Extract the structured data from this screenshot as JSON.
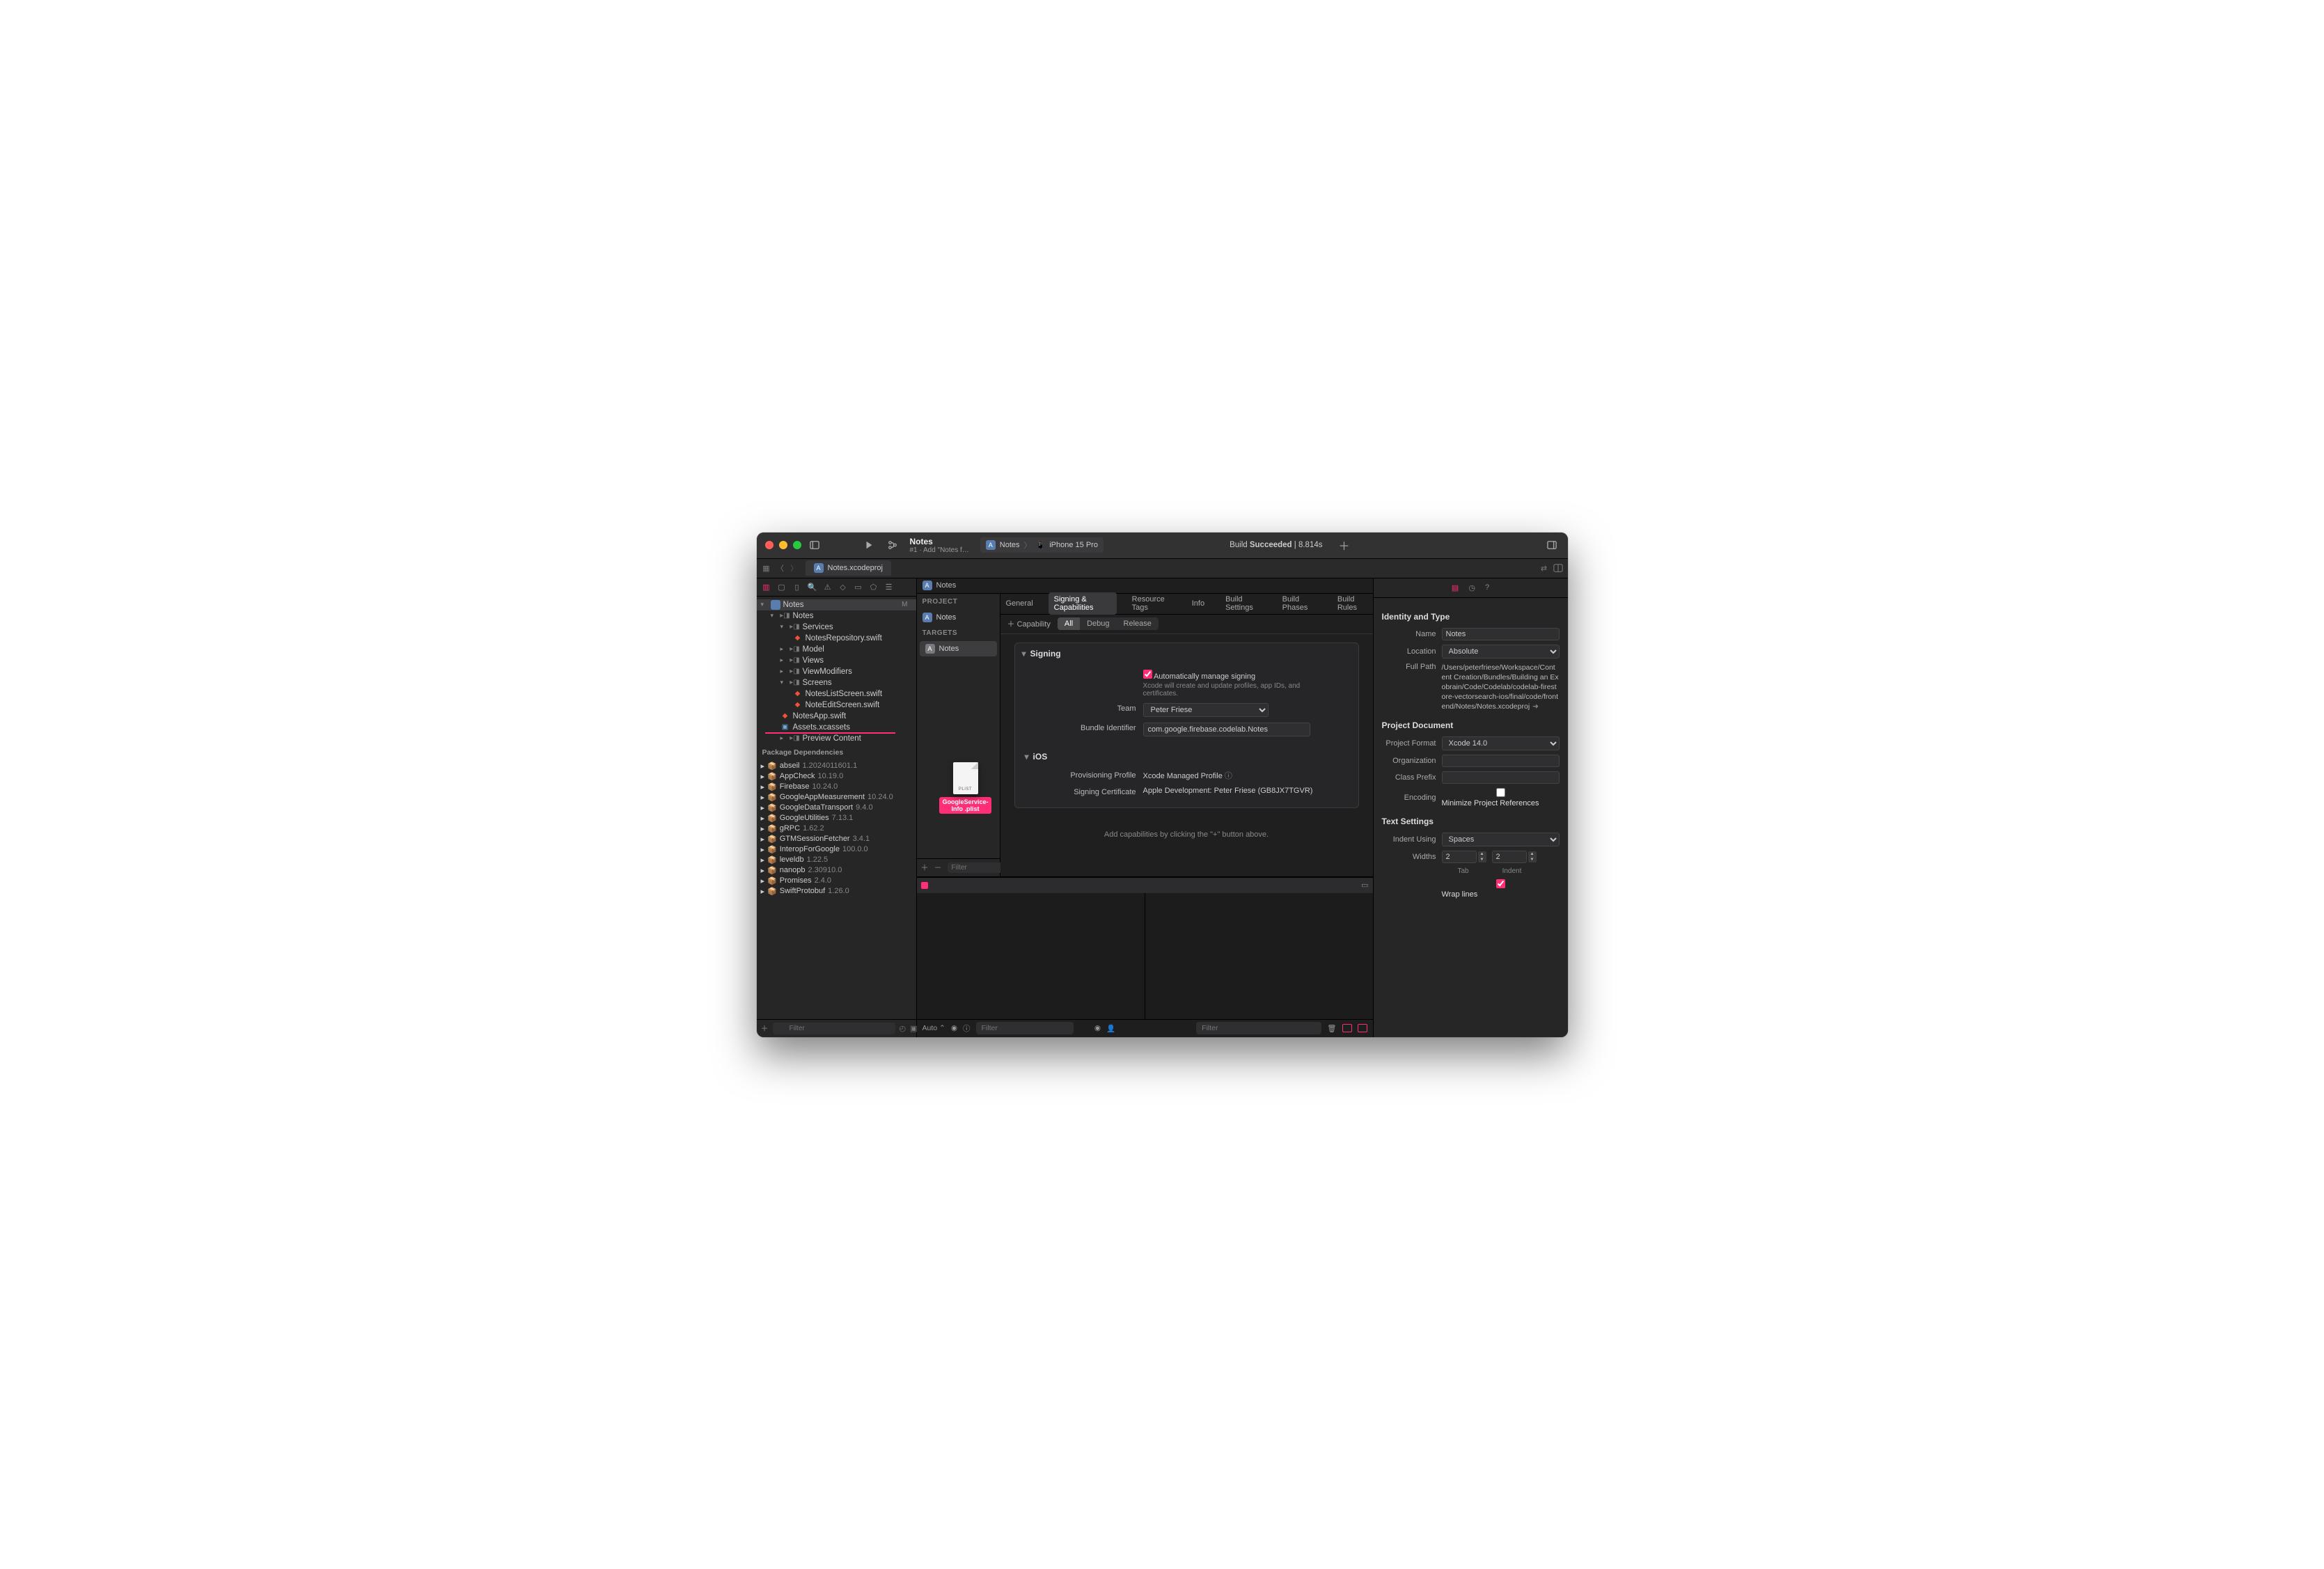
{
  "titlebar": {
    "project": "Notes",
    "subtitle": "#1 · Add \"Notes f…",
    "scheme_target": "Notes",
    "scheme_device": "iPhone 15 Pro",
    "build_prefix": "Build ",
    "build_status": "Succeeded",
    "build_time": " | 8.814s"
  },
  "tab": {
    "file": "Notes.xcodeproj"
  },
  "crumb": {
    "item": "Notes"
  },
  "tree": {
    "root": "Notes",
    "root_mod": "M",
    "group_notes": "Notes",
    "services": "Services",
    "notes_repo": "NotesRepository.swift",
    "model": "Model",
    "views": "Views",
    "viewmods": "ViewModifiers",
    "screens": "Screens",
    "notes_list": "NotesListScreen.swift",
    "note_edit": "NoteEditScreen.swift",
    "notes_app": "NotesApp.swift",
    "assets": "Assets.xcassets",
    "preview": "Preview Content"
  },
  "packages_header": "Package Dependencies",
  "packages": [
    {
      "name": "abseil",
      "ver": "1.2024011601.1"
    },
    {
      "name": "AppCheck",
      "ver": "10.19.0"
    },
    {
      "name": "Firebase",
      "ver": "10.24.0"
    },
    {
      "name": "GoogleAppMeasurement",
      "ver": "10.24.0"
    },
    {
      "name": "GoogleDataTransport",
      "ver": "9.4.0"
    },
    {
      "name": "GoogleUtilities",
      "ver": "7.13.1"
    },
    {
      "name": "gRPC",
      "ver": "1.62.2"
    },
    {
      "name": "GTMSessionFetcher",
      "ver": "3.4.1"
    },
    {
      "name": "InteropForGoogle",
      "ver": "100.0.0"
    },
    {
      "name": "leveldb",
      "ver": "1.22.5"
    },
    {
      "name": "nanopb",
      "ver": "2.30910.0"
    },
    {
      "name": "Promises",
      "ver": "2.4.0"
    },
    {
      "name": "SwiftProtobuf",
      "ver": "1.26.0"
    }
  ],
  "filter_placeholder": "Filter",
  "proj_editor": {
    "section_project": "PROJECT",
    "section_targets": "TARGETS",
    "project_item": "Notes",
    "target_item": "Notes",
    "tabs": {
      "general": "General",
      "signing": "Signing & Capabilities",
      "resource": "Resource Tags",
      "info": "Info",
      "buildsettings": "Build Settings",
      "phases": "Build Phases",
      "rules": "Build Rules"
    },
    "add_capability": "Capability",
    "seg": {
      "all": "All",
      "debug": "Debug",
      "release": "Release"
    },
    "signing_header": "Signing",
    "auto_label": "Automatically manage signing",
    "auto_hint": "Xcode will create and update profiles, app IDs, and certificates.",
    "team_label": "Team",
    "team_value": "Peter Friese",
    "bundle_label": "Bundle Identifier",
    "bundle_value": "com.google.firebase.codelab.Notes",
    "ios_header": "iOS",
    "provprof_label": "Provisioning Profile",
    "provprof_value": "Xcode Managed Profile",
    "cert_label": "Signing Certificate",
    "cert_value": "Apple Development: Peter Friese (GB8JX7TGVR)",
    "add_hint": "Add capabilities by clicking the \"+\" button above."
  },
  "debugbar": {
    "auto": "Auto"
  },
  "inspector": {
    "identity_header": "Identity and Type",
    "name_label": "Name",
    "name_value": "Notes",
    "location_label": "Location",
    "location_value": "Absolute",
    "fullpath_label": "Full Path",
    "fullpath_value": "/Users/peterfriese/Workspace/Content Creation/Bundles/Building an Exobrain/Code/Codelab/codelab-firestore-vectorsearch-ios/final/code/frontend/Notes/Notes.xcodeproj",
    "projdoc_header": "Project Document",
    "projformat_label": "Project Format",
    "projformat_value": "Xcode 14.0",
    "org_label": "Organization",
    "classprefix_label": "Class Prefix",
    "encoding_label": "Encoding",
    "minimize_label": "Minimize Project References",
    "text_header": "Text Settings",
    "indent_label": "Indent Using",
    "indent_value": "Spaces",
    "widths_label": "Widths",
    "tab_width": "2",
    "indent_width": "2",
    "tab_caption": "Tab",
    "indent_caption": "Indent",
    "wrap_label": "Wrap lines"
  },
  "drag": {
    "doc_label": "PLIST",
    "filename": "GoogleService-Info .plist"
  }
}
